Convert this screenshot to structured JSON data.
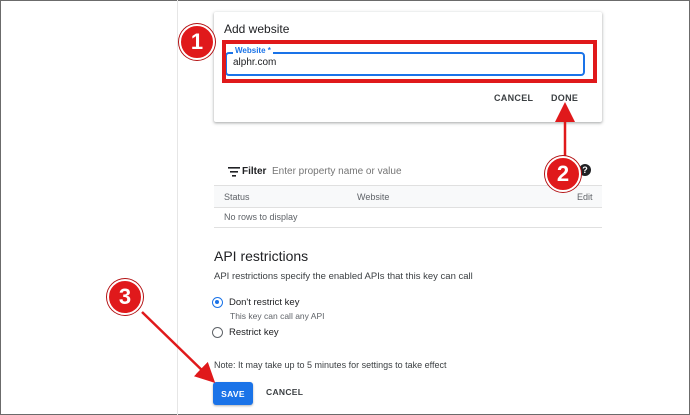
{
  "add_website": {
    "title": "Add website",
    "field_label": "Website *",
    "field_value": "alphr.com",
    "cancel_label": "CANCEL",
    "done_label": "DONE"
  },
  "filter": {
    "label": "Filter",
    "placeholder": "Enter property name or value",
    "help": "?"
  },
  "table": {
    "columns": [
      "Status",
      "Website",
      "Edit"
    ],
    "empty_text": "No rows to display"
  },
  "api": {
    "title": "API restrictions",
    "description": "API restrictions specify the enabled APIs that this key can call",
    "options": [
      {
        "label": "Don't restrict key",
        "sublabel": "This key can call any API",
        "checked": true
      },
      {
        "label": "Restrict key",
        "checked": false
      }
    ],
    "note": "Note: It may take up to 5 minutes for settings to take effect",
    "save_label": "SAVE",
    "cancel_label": "CANCEL"
  },
  "annotations": {
    "badge_1": "1",
    "badge_2": "2",
    "badge_3": "3",
    "color": "#e0191b"
  },
  "colors": {
    "accent": "#1a73e8",
    "text": "#202124",
    "muted": "#5f6368"
  }
}
